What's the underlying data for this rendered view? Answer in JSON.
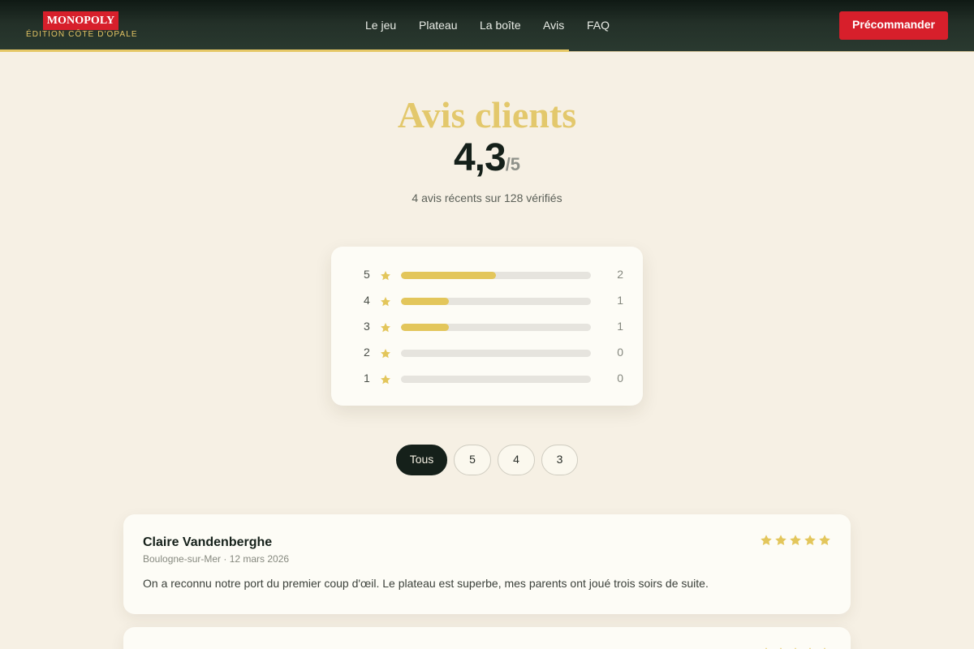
{
  "header": {
    "brand": "MONOPOLY",
    "brand_sub": "ÉDITION CÔTE D'OPALE",
    "nav": [
      "Le jeu",
      "Plateau",
      "La boîte",
      "Avis",
      "FAQ"
    ],
    "cta": "Précommander"
  },
  "reviews_section": {
    "title": "Avis clients",
    "score": "4,3",
    "score_max": "/5",
    "summary": "4 avis récents sur 128 vérifiés"
  },
  "distribution": [
    {
      "stars": "5",
      "count": "2",
      "share": 0.5
    },
    {
      "stars": "4",
      "count": "1",
      "share": 0.25
    },
    {
      "stars": "3",
      "count": "1",
      "share": 0.25
    },
    {
      "stars": "2",
      "count": "0",
      "share": 0
    },
    {
      "stars": "1",
      "count": "0",
      "share": 0
    }
  ],
  "filters": [
    "Tous",
    "5",
    "4",
    "3"
  ],
  "active_filter": "Tous",
  "reviews": [
    {
      "name": "Claire Vandenberghe",
      "meta": "Boulogne-sur-Mer · 12 mars 2026",
      "text": "On a reconnu notre port du premier coup d'œil. Le plateau est superbe, mes parents ont joué trois soirs de suite.",
      "rating": 5
    },
    {
      "name": "",
      "meta": "",
      "text": "",
      "rating": 5
    }
  ],
  "colors": {
    "accent_red": "#d71f2b",
    "gold": "#e3c65b",
    "dark": "#15201a",
    "background": "#f6f0e4"
  }
}
